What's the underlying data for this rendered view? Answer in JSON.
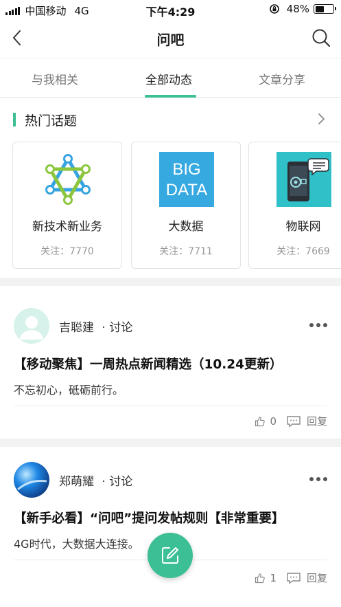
{
  "status_bar": {
    "carrier": "中国移动",
    "network": "4G",
    "time": "下午4:29",
    "battery": "48%",
    "battery_level": 0.48
  },
  "nav": {
    "title": "问吧",
    "back_icon": "chevron-left-icon",
    "search_icon": "search-icon"
  },
  "tabs": [
    {
      "label": "与我相关"
    },
    {
      "label": "全部动态",
      "active": true
    },
    {
      "label": "文章分享"
    }
  ],
  "hot_topics": {
    "title": "热门话题",
    "arrow_icon": "chevron-right-icon",
    "cards": [
      {
        "name": "新技术新业务",
        "follow": "关注：7770",
        "icon": "hexagram-network-icon"
      },
      {
        "name": "大数据",
        "follow": "关注：7711",
        "icon": "big-data-icon",
        "image_text": [
          "BIG",
          "DATA"
        ]
      },
      {
        "name": "物联网",
        "follow": "关注：7669",
        "icon": "iot-phone-icon"
      }
    ]
  },
  "posts": [
    {
      "author": "吉聪建",
      "type": "· 讨论",
      "title": "【移动聚焦】一周热点新闻精选（10.24更新）",
      "excerpt": "不忘初心，砥砺前行。",
      "likes": "0",
      "reply_label": "回复"
    },
    {
      "author": "郑萌耀",
      "type": "· 讨论",
      "title": "【新手必看】“问吧”提问发帖规则【非常重要】",
      "excerpt": "4G时代，大数据大连接。",
      "likes": "1",
      "reply_label": "回复"
    }
  ],
  "colors": {
    "accent": "#3dbf96",
    "big_data_bg": "#36a9e1",
    "iot_bg": "#2fc0c8"
  },
  "fab_icon": "compose-icon"
}
